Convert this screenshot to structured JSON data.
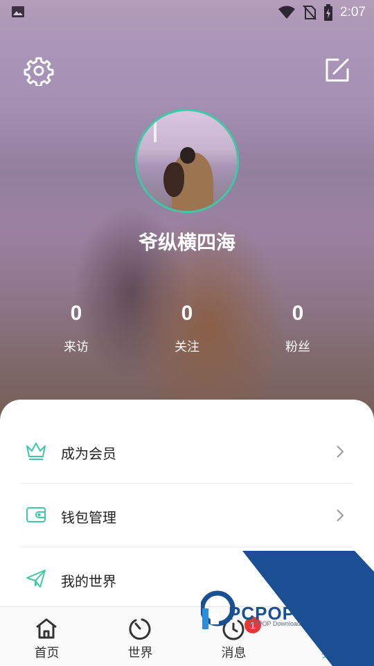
{
  "status_bar": {
    "time": "2:07",
    "left_icon": "image-icon",
    "right_icons": [
      "wifi-icon",
      "no-sim-icon",
      "battery-charging-icon"
    ]
  },
  "header": {
    "settings_icon": "gear-icon",
    "edit_icon": "edit-icon"
  },
  "profile": {
    "username": "爷纵横四海",
    "stats": [
      {
        "value": "0",
        "label": "来访"
      },
      {
        "value": "0",
        "label": "关注"
      },
      {
        "value": "0",
        "label": "粉丝"
      }
    ]
  },
  "menu": {
    "items": [
      {
        "label": "成为会员",
        "icon": "crown-icon"
      },
      {
        "label": "钱包管理",
        "icon": "wallet-icon"
      },
      {
        "label": "我的世界",
        "icon": "paper-plane-icon"
      }
    ]
  },
  "bottom_nav": {
    "items": [
      {
        "label": "首页",
        "icon": "home-icon"
      },
      {
        "label": "世界",
        "icon": "compass-icon"
      },
      {
        "label": "消息",
        "icon": "message-icon",
        "badge": "1"
      },
      {
        "label": "我",
        "icon": "profile-icon",
        "active": true
      }
    ]
  },
  "watermark": {
    "brand": "PCPOP下载",
    "sub": "PCPOP Download"
  },
  "colors": {
    "accent": "#3ec8a8",
    "badge": "#e53935",
    "watermark_blue": "#1b4f93"
  }
}
